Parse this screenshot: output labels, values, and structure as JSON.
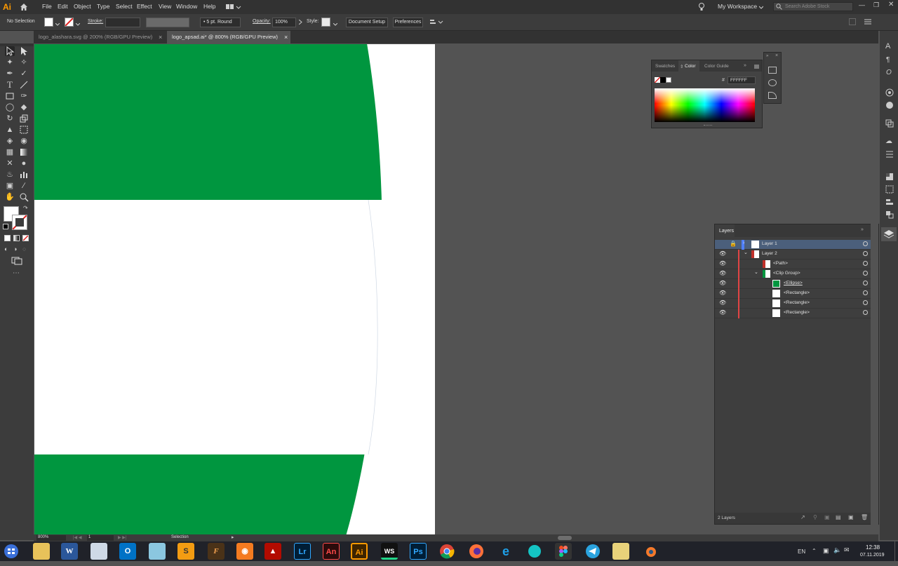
{
  "app": {
    "logo": "Ai",
    "accent": "#ff9a00"
  },
  "menu": [
    "File",
    "Edit",
    "Object",
    "Type",
    "Select",
    "Effect",
    "View",
    "Window",
    "Help"
  ],
  "workspace": "My Workspace",
  "search_placeholder": "Search Adobe Stock",
  "control": {
    "selection": "No Selection",
    "stroke_label": "Stroke:",
    "brush": "5 pt. Round",
    "opacity_label": "Opacity:",
    "opacity_value": "100%",
    "style_label": "Style:",
    "document_setup": "Document Setup",
    "preferences": "Preferences"
  },
  "tabs": [
    {
      "label": "logo_alashara.svg @ 200% (RGB/GPU Preview)",
      "close": "×"
    },
    {
      "label": "logo_apsad.ai* @ 800% (RGB/GPU Preview)",
      "close": "×"
    }
  ],
  "artwork": {
    "green": "#00963f",
    "white": "#ffffff"
  },
  "color_panel": {
    "tabs": [
      "Swatches",
      "Color",
      "Color Guide"
    ],
    "hash": "#",
    "hex": "FFFFFF"
  },
  "layers_panel": {
    "title": "Layers",
    "footer": "2 Layers",
    "rows": [
      {
        "name": "Layer 1"
      },
      {
        "name": "Layer 2"
      },
      {
        "name": "<Path>"
      },
      {
        "name": "<Clip Group>"
      },
      {
        "name": "<Ellipse>"
      },
      {
        "name": "<Rectangle>"
      },
      {
        "name": "<Rectangle>"
      },
      {
        "name": "<Rectangle>"
      }
    ]
  },
  "status": {
    "zoom": "800%",
    "artboard": "1",
    "tool": "Selection"
  },
  "taskbar": {
    "apps": [
      "Ps",
      "Ai",
      "Lr",
      "An",
      "WS",
      "F",
      "W"
    ],
    "lang": "EN",
    "time": "12:38",
    "date": "07.11.2019"
  }
}
